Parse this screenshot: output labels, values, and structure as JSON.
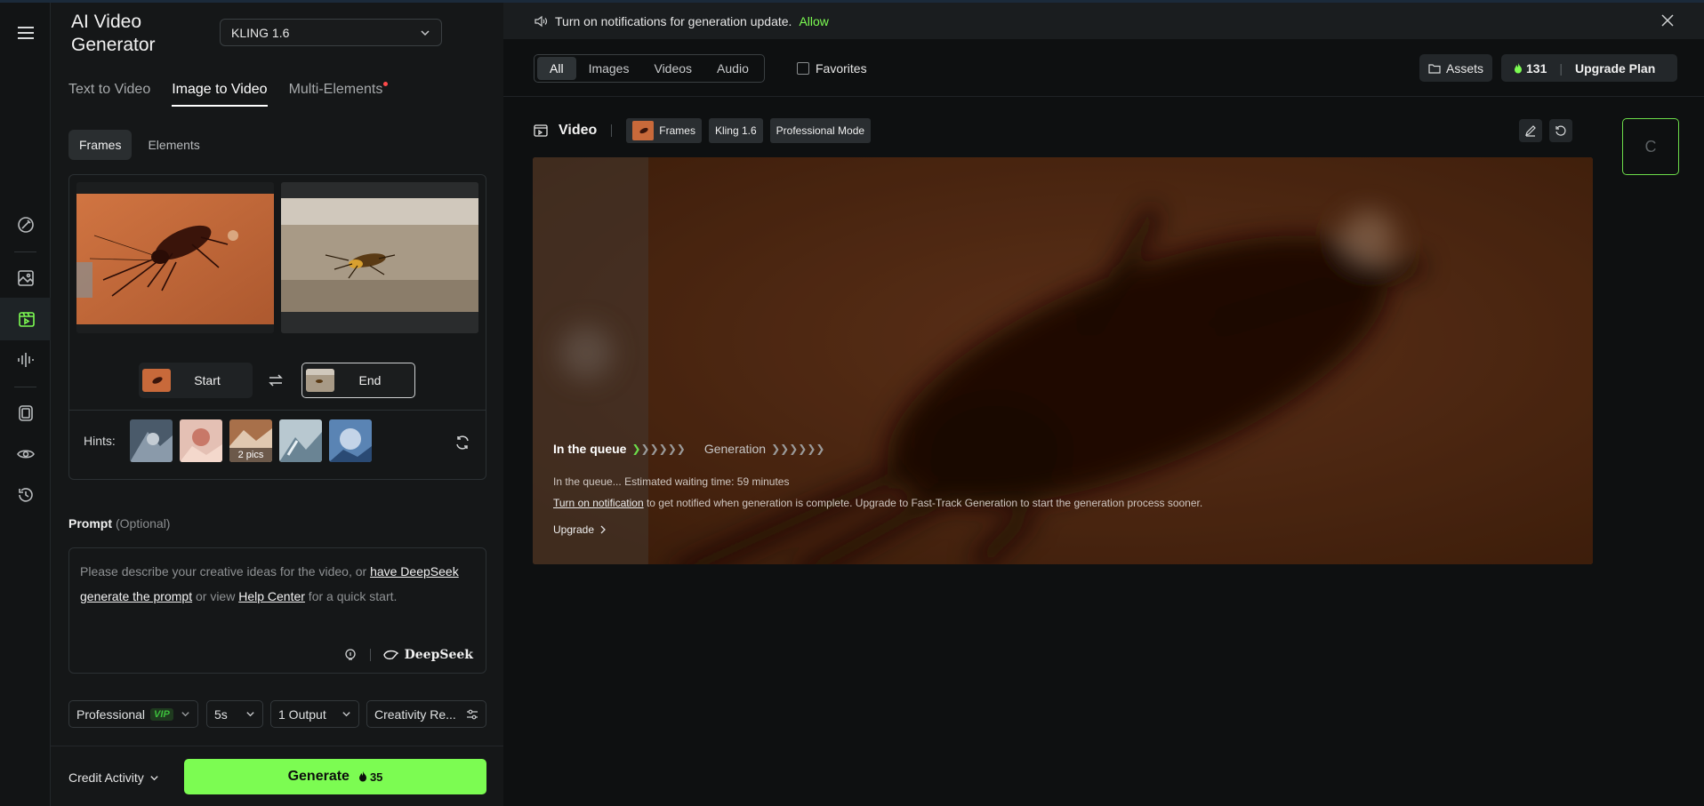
{
  "colors": {
    "accent": "#7cfc52",
    "background": "#0e1011",
    "panel": "#151718",
    "notification_dot": "#ff4a4a"
  },
  "rail": {
    "icons": [
      "menu-icon",
      "magic-pen-icon",
      "image-icon",
      "video-icon",
      "audio-wave-icon",
      "frame-icon",
      "eye-icon",
      "history-icon"
    ]
  },
  "panel": {
    "app_title": "AI Video Generator",
    "model": "KLING 1.6",
    "tabs": [
      {
        "label": "Text to Video"
      },
      {
        "label": "Image to Video"
      },
      {
        "label": "Multi-Elements"
      }
    ],
    "subtabs": [
      {
        "label": "Frames"
      },
      {
        "label": "Elements"
      }
    ],
    "frames": {
      "start_label": "Start",
      "end_label": "End"
    },
    "hints": {
      "label": "Hints:",
      "badge": "2 pics"
    },
    "prompt": {
      "title": "Prompt",
      "optional": "(Optional)",
      "text_1": "Please describe your creative ideas for the video, or ",
      "link_1": "have DeepSeek generate the prompt",
      "text_2": " or view ",
      "link_2": "Help Center",
      "text_3": " for a quick start.",
      "deepseek": "DeepSeek"
    },
    "options": {
      "mode": "Professional",
      "vip": "VIP",
      "duration": "5s",
      "outputs": "1 Output",
      "creativity": "Creativity Re..."
    },
    "footer": {
      "credit_activity": "Credit Activity",
      "generate": "Generate",
      "cost": "35"
    }
  },
  "main": {
    "notification": {
      "text": "Turn on notifications for generation update.",
      "allow": "Allow"
    },
    "filters": [
      {
        "label": "All"
      },
      {
        "label": "Images"
      },
      {
        "label": "Videos"
      },
      {
        "label": "Audio"
      }
    ],
    "favorites": "Favorites",
    "assets": "Assets",
    "credits": "131",
    "upgrade_plan": "Upgrade Plan",
    "video": {
      "title": "Video",
      "tags": [
        "Frames",
        "Kling 1.6",
        "Professional Mode"
      ],
      "loader": "C",
      "queue_label": "In the queue",
      "generation_label": "Generation",
      "wait_text": "In the queue... Estimated waiting time: 59 minutes",
      "notif_link": "Turn on notification",
      "notif_text": " to get notified when generation is complete. Upgrade to Fast-Track Generation to start the generation process sooner.",
      "upgrade": "Upgrade"
    }
  }
}
